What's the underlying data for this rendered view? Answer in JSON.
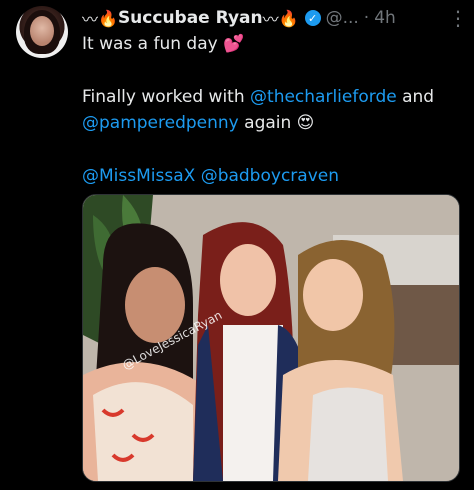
{
  "header": {
    "emoji_prefix_1": "〰",
    "emoji_prefix_2": "🔥",
    "display_name": "Succubae Ryan",
    "emoji_suffix_1": "〰",
    "emoji_suffix_2": "🔥",
    "verified_mark": "✓",
    "handle": "@...",
    "separator": "·",
    "time": "4h",
    "more_label": "⋮"
  },
  "tweet": {
    "line1": "It was a fun day 💕",
    "line2_prefix": "Finally worked with ",
    "line2_mention": "@thecharlieforde",
    "line2_suffix": " and",
    "line3_mention": "@pamperedpenny",
    "line3_suffix": " again 😍",
    "line4_mention1": "@MissMissaX",
    "line4_mention2": "@badboycraven"
  },
  "media": {
    "watermark": "@LoveJessicaRyan"
  },
  "colors": {
    "background": "#000000",
    "text": "#e7e9ea",
    "muted": "#71767b",
    "accent": "#1d9bf0"
  }
}
